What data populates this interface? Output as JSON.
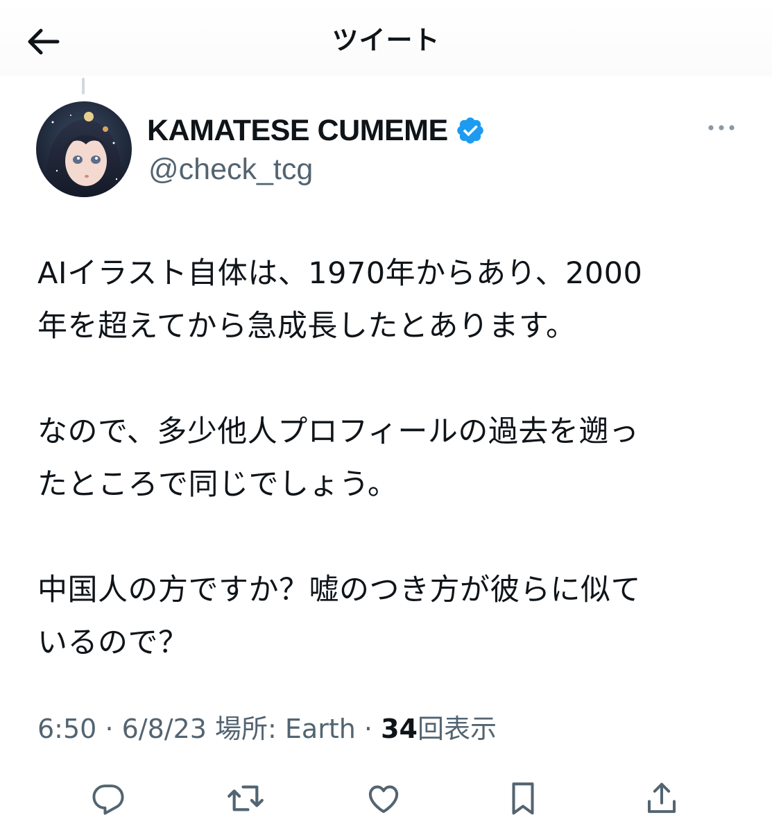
{
  "header": {
    "title": "ツイート",
    "back_icon": "arrow-left-icon"
  },
  "author": {
    "display_name": "KAMATESE CUMEME",
    "handle": "@check_tcg",
    "verified": true,
    "verified_color": "#1d9bf0"
  },
  "tweet": {
    "paragraphs": [
      [
        "AIイラスト自体は、1970年からあり、2000",
        "年を超えてから急成長したとあります。"
      ],
      [
        "なので、多少他人プロフィールの過去を遡っ",
        "たところで同じでしょう。"
      ],
      [
        "中国人の方ですか？嘘のつき方が彼らに似て",
        "いるので？"
      ]
    ]
  },
  "meta": {
    "time": "6:50",
    "date": "6/8/23",
    "location_label": "場所: Earth",
    "views_count": "34",
    "views_label": "回表示",
    "separator": "·"
  },
  "actions": [
    {
      "name": "reply-icon"
    },
    {
      "name": "retweet-icon"
    },
    {
      "name": "like-icon"
    },
    {
      "name": "bookmark-icon"
    },
    {
      "name": "share-icon"
    }
  ],
  "colors": {
    "text": "#0f1419",
    "secondary": "#536471",
    "accent": "#1d9bf0"
  }
}
